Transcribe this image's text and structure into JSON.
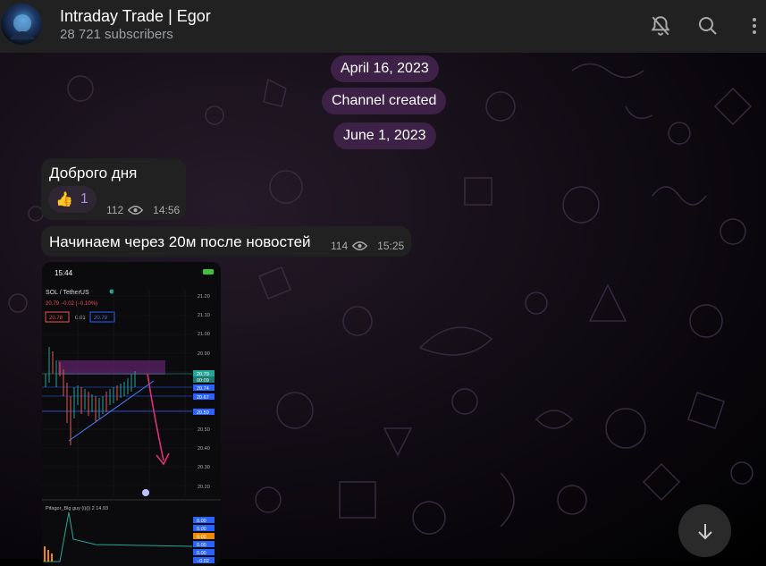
{
  "header": {
    "channel_name": "Intraday Trade | Egor",
    "subscribers": "28 721 subscribers",
    "icons": [
      "bell-off-icon",
      "search-icon",
      "more-vertical-icon"
    ]
  },
  "service": {
    "date1": "April 16, 2023",
    "created": "Channel created",
    "date2": "June 1, 2023"
  },
  "messages": [
    {
      "text": "Доброго дня",
      "reaction_emoji": "👍",
      "reaction_count": "1",
      "views": "112",
      "time": "14:56"
    },
    {
      "text": "Начинаем через 20м после новостей",
      "views": "114",
      "time": "15:25"
    }
  ],
  "photo": {
    "status_time": "15:44",
    "pair": "SOL / TetherUS",
    "price_line": "20.79 −0.02 (−0.10%)",
    "bid": "20.78",
    "spread": "0.01",
    "ask": "20.79",
    "y_ticks": [
      "21.20",
      "21.10",
      "21.00",
      "20.90",
      "20.79",
      "00:09",
      "20.74",
      "20.67",
      "20.59",
      "20.50",
      "20.40",
      "20.30",
      "20.20"
    ],
    "indicator_label": "Pifagor_Big guy (i)(i) 2 14.93",
    "indicator_ticks": [
      "0.00",
      "0.00",
      "0.00",
      "0.00",
      "0.00",
      "−0.02"
    ],
    "colors": {
      "green": "#26a69a",
      "red": "#ef5350",
      "blue": "#2962ff",
      "purple": "#7b2a8a",
      "pink": "#e0307a"
    }
  },
  "scroll_button": {
    "icon": "arrow-down-icon"
  }
}
